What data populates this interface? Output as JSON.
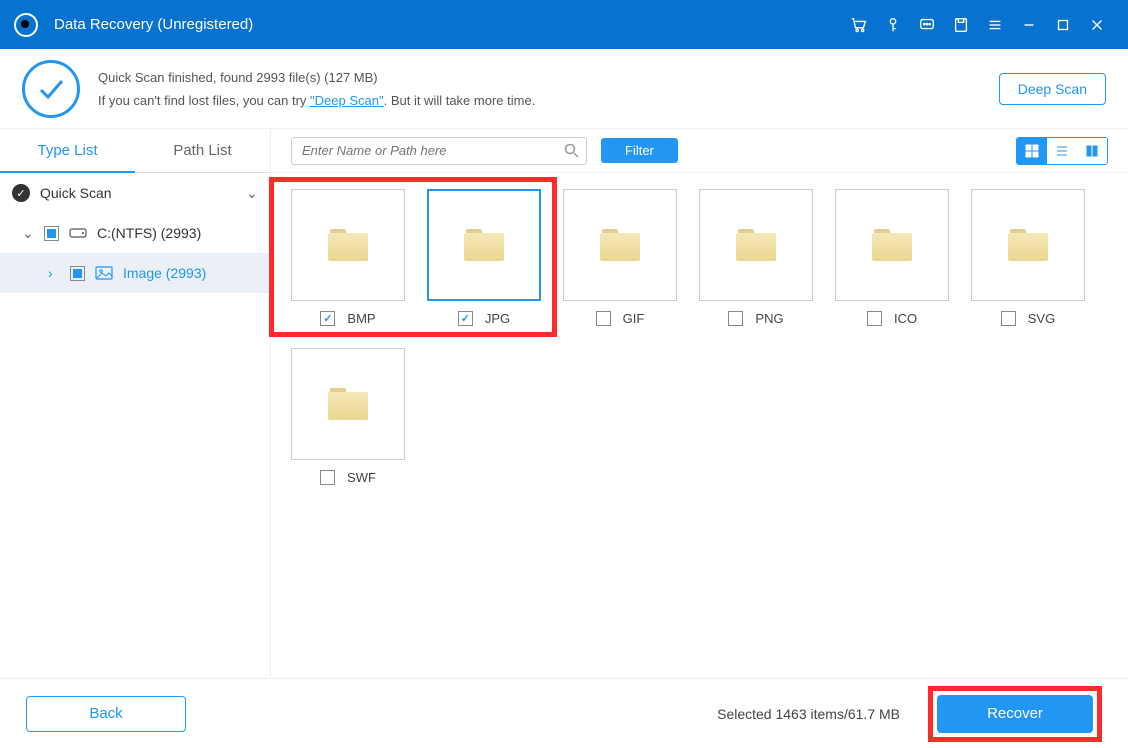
{
  "titlebar": {
    "title": "Data Recovery (Unregistered)"
  },
  "status": {
    "line1": "Quick Scan finished, found 2993 file(s) (127 MB)",
    "line2_pre": "If you can't find lost files, you can try ",
    "line2_link": "\"Deep Scan\"",
    "line2_post": ". But it will take more time.",
    "deep_scan_btn": "Deep Scan"
  },
  "sidebar": {
    "tabs": {
      "type": "Type List",
      "path": "Path List"
    },
    "quick_scan": "Quick Scan",
    "drive": "C:(NTFS) (2993)",
    "image_node": "Image (2993)"
  },
  "toolbar": {
    "search_placeholder": "Enter Name or Path here",
    "filter": "Filter"
  },
  "items": [
    {
      "label": "BMP",
      "checked": true,
      "selected": false
    },
    {
      "label": "JPG",
      "checked": true,
      "selected": true
    },
    {
      "label": "GIF",
      "checked": false,
      "selected": false
    },
    {
      "label": "PNG",
      "checked": false,
      "selected": false
    },
    {
      "label": "ICO",
      "checked": false,
      "selected": false
    },
    {
      "label": "SVG",
      "checked": false,
      "selected": false
    },
    {
      "label": "SWF",
      "checked": false,
      "selected": false
    }
  ],
  "footer": {
    "back": "Back",
    "selected": "Selected 1463 items/61.7 MB",
    "recover": "Recover"
  }
}
